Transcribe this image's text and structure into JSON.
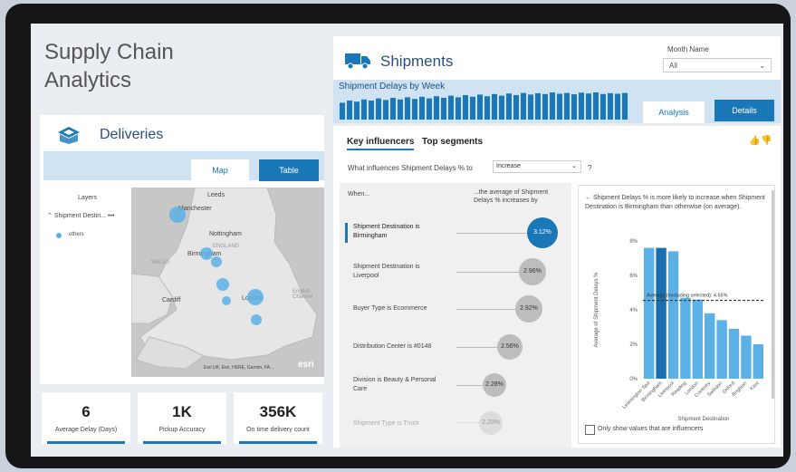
{
  "colors": {
    "accent": "#1a78b8",
    "light_band": "#cfe3f2",
    "bar_light": "#5bb0e6",
    "bar_dark": "#1a6fae",
    "circle_grey": "#bdbdbd"
  },
  "app_title_line1": "Supply Chain",
  "app_title_line2": "Analytics",
  "deliveries": {
    "title": "Deliveries",
    "icon": "box-icon",
    "tabs": [
      "Map",
      "Table"
    ],
    "active_tab": "Table",
    "layers": {
      "title": "Layers",
      "item": "Shipment Destin...",
      "legend": "others"
    },
    "map_labels": [
      "Leeds",
      "Manchester",
      "Nottingham",
      "ENGLAND",
      "Birmingham",
      "WALES",
      "Cardiff",
      "London",
      "English Channel"
    ],
    "attribution": "Esri UK, Esri, HERE, Garmin, FA...",
    "logo": "esri"
  },
  "kpis": [
    {
      "value": "6",
      "label": "Average Delay (Days)"
    },
    {
      "value": "1K",
      "label": "Pickup Accuracy"
    },
    {
      "value": "356K",
      "label": "On time delivery count"
    }
  ],
  "shipments": {
    "title": "Shipments",
    "icon": "truck-icon",
    "month": {
      "label": "Month Name",
      "value": "All"
    },
    "delays_title": "Shipment Delays by Week",
    "weekly_bars": [
      0.62,
      0.7,
      0.66,
      0.74,
      0.7,
      0.78,
      0.72,
      0.8,
      0.74,
      0.82,
      0.76,
      0.84,
      0.78,
      0.86,
      0.8,
      0.88,
      0.82,
      0.9,
      0.84,
      0.92,
      0.86,
      0.94,
      0.88,
      0.96,
      0.9,
      0.98,
      0.92,
      0.97,
      0.94,
      1.0,
      0.95,
      0.98,
      0.93,
      0.99,
      0.96,
      1.0,
      0.94,
      0.97,
      0.95,
      0.98
    ],
    "tabs": [
      "Analysis",
      "Details"
    ],
    "active_tab": "Details"
  },
  "key_influencers": {
    "tabs": [
      "Key influencers",
      "Top segments"
    ],
    "question": "What influences Shipment Delays % to",
    "question_value": "Increase",
    "question_suffix": "?",
    "col_when": "When...",
    "col_avg": "...the average of Shipment Delays % increases by",
    "rows": [
      {
        "label": "Shipment Destination is Birmingham",
        "value": "3.12%",
        "selected": true
      },
      {
        "label": "Shipment Destination is Liverpool",
        "value": "2.96%",
        "selected": false
      },
      {
        "label": "Buyer Type is Ecommerce",
        "value": "2.92%",
        "selected": false
      },
      {
        "label": "Distribution Center is #0148",
        "value": "2.56%",
        "selected": false
      },
      {
        "label": "Division is Beauty & Personal Care",
        "value": "2.28%",
        "selected": false
      },
      {
        "label": "Shipment Type is Truck",
        "value": "2.20%",
        "selected": false
      }
    ],
    "detail_text": "Shipment Delays % is more likely to increase when Shipment Destination is Birmingham than otherwise (on average).",
    "checkbox_label": "Only show values that are influencers"
  },
  "chart_data": {
    "type": "bar",
    "title": "",
    "xlabel": "Shipment Destination",
    "ylabel": "Average of Shipment Delays %",
    "categories": [
      "Leamington Spa",
      "Birmingham",
      "Liverpool",
      "Reading",
      "London",
      "Coventry",
      "Swindon",
      "Oxford",
      "Brighton",
      "Kent"
    ],
    "values": [
      7.6,
      7.6,
      7.4,
      4.7,
      4.6,
      3.8,
      3.4,
      2.9,
      2.5,
      2.0
    ],
    "highlighted": "Birmingham",
    "ylim": [
      0,
      8
    ],
    "yticks": [
      "0%",
      "2%",
      "4%",
      "6%",
      "8%"
    ],
    "reference_line": {
      "value": 4.55,
      "label": "Average (excluding selected): 4.55%"
    }
  }
}
